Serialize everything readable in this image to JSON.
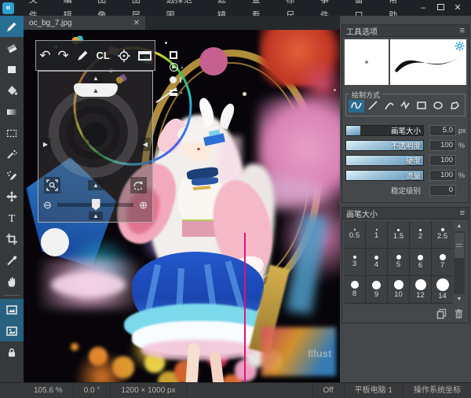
{
  "titlebar": {
    "menus": [
      "文件",
      "编辑",
      "图像",
      "图层",
      "选择范围",
      "滤镜",
      "查看",
      "标尺",
      "事件",
      "窗口",
      "帮助"
    ],
    "controls": {
      "minimize": "–",
      "close": "✕"
    }
  },
  "tab": {
    "title": "oc_bg_7.jpg",
    "close": "✕"
  },
  "floating_toolbar": {
    "undo": "↶",
    "redo": "↷",
    "clear": "CL"
  },
  "navigator": {
    "up": "▲",
    "down": "▲",
    "left": "▶",
    "right": "◀",
    "fan": "▲",
    "center_up": "▲",
    "zoom_out": "⊖",
    "zoom_in": "⊕",
    "bottom_up": "▲"
  },
  "tool_options": {
    "title": "工具选项",
    "menu_icon": "≡",
    "draw_method_label": "绘制方式",
    "sliders": [
      {
        "label": "画笔大小",
        "value": "5.0",
        "unit": "px",
        "fill": 18
      },
      {
        "label": "不透明度",
        "value": "100",
        "unit": "%",
        "fill": 100
      },
      {
        "label": "硬度",
        "value": "100",
        "unit": "",
        "fill": 100
      },
      {
        "label": "流量",
        "value": "100",
        "unit": "%",
        "fill": 100
      },
      {
        "label": "稳定级别",
        "value": "0",
        "unit": "",
        "fill": 0
      }
    ]
  },
  "brush_panel": {
    "title": "画笔大小",
    "menu_icon": "≡",
    "scroll_up": "▲",
    "scroll_down": "▼",
    "sizes": [
      "0.5",
      "1",
      "1.5",
      "2",
      "2.5",
      "3",
      "4",
      "5",
      "6",
      "7",
      "8",
      "9",
      "10",
      "12",
      "14"
    ]
  },
  "statusbar": {
    "zoom": "105.6 %",
    "angle": "0.0 °",
    "size": "1200 × 1000 px",
    "toggle": "Off",
    "tablet": "平板电脑 1",
    "coords": "操作系统坐标"
  },
  "canvas": {
    "watermark": "Illust"
  },
  "colors": {
    "accent": "#2f9fd0",
    "tool_selected": "#286f94",
    "slider_fill": "#5d92b6"
  }
}
